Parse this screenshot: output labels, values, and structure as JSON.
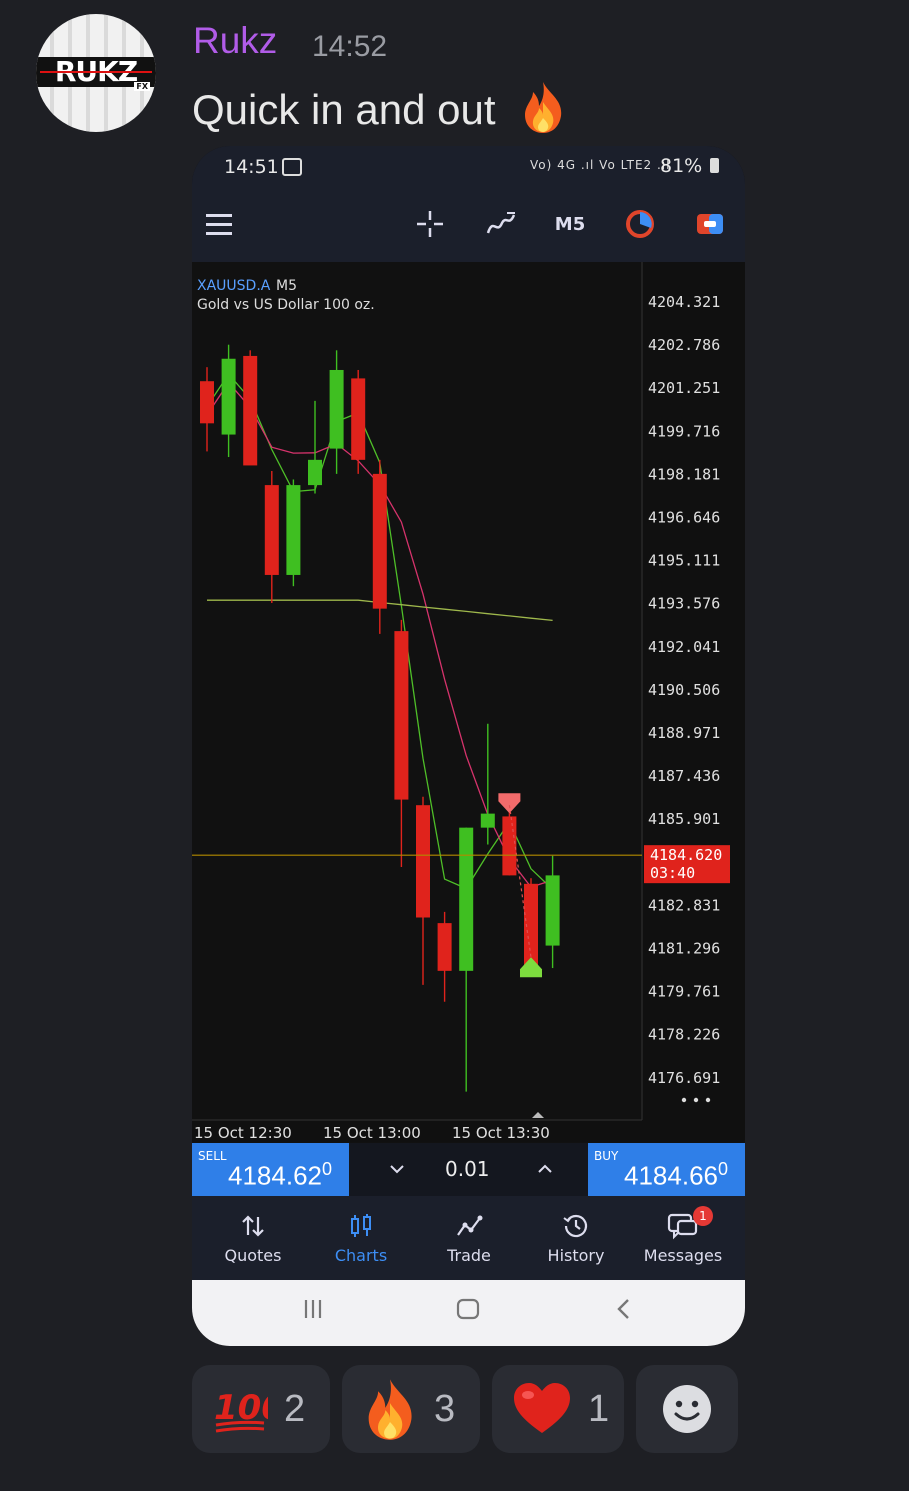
{
  "message": {
    "username": "Rukz",
    "timestamp": "14:52",
    "text": "Quick in and out",
    "text_emoji_icon": "fire-icon",
    "avatar_logo_text": "RUKZ",
    "avatar_logo_sub": "FX",
    "username_color": "#b15ce8"
  },
  "phone": {
    "status_bar": {
      "time": "14:51",
      "icons_text": "Vo) 4G .ıl Vo LTE2 .ıl",
      "battery": "81%"
    },
    "toolbar": {
      "timeframe": "M5",
      "icons": [
        "menu-icon",
        "crosshair-icon",
        "indicators-icon",
        "objects-icon",
        "trade-icon"
      ]
    },
    "chart": {
      "symbol": "XAUUSD.A",
      "symbol_timeframe": "M5",
      "description": "Gold vs US Dollar 100 oz.",
      "current_price": "4184.620",
      "countdown": "03:40",
      "more_icon": "more-dots-icon"
    },
    "order_bar": {
      "sell_label": "SELL",
      "sell_price_main": "4184.62",
      "sell_price_sup": "0",
      "volume": "0.01",
      "buy_label": "BUY",
      "buy_price_main": "4184.66",
      "buy_price_sup": "0",
      "accent": "#2f7fe8"
    },
    "bottom_nav": [
      {
        "label": "Quotes",
        "icon": "quotes-arrows-icon"
      },
      {
        "label": "Charts",
        "icon": "candles-icon"
      },
      {
        "label": "Trade",
        "icon": "trade-line-icon"
      },
      {
        "label": "History",
        "icon": "history-clock-icon"
      },
      {
        "label": "Messages",
        "icon": "messages-icon",
        "badge": "1"
      }
    ]
  },
  "chart_data": {
    "type": "candlestick",
    "price_axis_ticks": [
      "4204.321",
      "4202.786",
      "4201.251",
      "4199.716",
      "4198.181",
      "4196.646",
      "4195.111",
      "4193.576",
      "4192.041",
      "4190.506",
      "4188.971",
      "4187.436",
      "4185.901",
      "4182.831",
      "4181.296",
      "4179.761",
      "4178.226",
      "4176.691"
    ],
    "time_axis_ticks": [
      "15 Oct 12:30",
      "15 Oct 13:00",
      "15 Oct 13:30"
    ],
    "ylim": [
      4176.691,
      4204.321
    ],
    "bid_line": 4184.62,
    "candles": [
      {
        "o": 4201.5,
        "h": 4202.0,
        "l": 4199.0,
        "c": 4200.0
      },
      {
        "o": 4199.6,
        "h": 4202.8,
        "l": 4198.8,
        "c": 4202.3
      },
      {
        "o": 4202.4,
        "h": 4202.6,
        "l": 4199.2,
        "c": 4198.5
      },
      {
        "o": 4197.8,
        "h": 4198.3,
        "l": 4193.6,
        "c": 4194.6
      },
      {
        "o": 4194.6,
        "h": 4198.0,
        "l": 4194.2,
        "c": 4197.8
      },
      {
        "o": 4197.8,
        "h": 4200.8,
        "l": 4197.5,
        "c": 4198.7
      },
      {
        "o": 4199.1,
        "h": 4202.6,
        "l": 4198.2,
        "c": 4201.9
      },
      {
        "o": 4201.6,
        "h": 4201.9,
        "l": 4198.2,
        "c": 4198.7
      },
      {
        "o": 4198.2,
        "h": 4198.7,
        "l": 4192.5,
        "c": 4193.4
      },
      {
        "o": 4192.6,
        "h": 4193.0,
        "l": 4184.2,
        "c": 4186.6
      },
      {
        "o": 4186.4,
        "h": 4186.7,
        "l": 4180.0,
        "c": 4182.4
      },
      {
        "o": 4182.2,
        "h": 4182.6,
        "l": 4179.4,
        "c": 4180.5
      },
      {
        "o": 4180.5,
        "h": 4185.6,
        "l": 4176.2,
        "c": 4185.6
      },
      {
        "o": 4185.6,
        "h": 4189.3,
        "l": 4185.0,
        "c": 4186.1
      },
      {
        "o": 4186.0,
        "h": 4186.5,
        "l": 4183.9,
        "c": 4183.9
      },
      {
        "o": 4183.6,
        "h": 4183.8,
        "l": 4181.4,
        "c": 4180.6
      },
      {
        "o": 4181.4,
        "h": 4184.6,
        "l": 4180.6,
        "c": 4183.9
      }
    ],
    "markers": [
      {
        "type": "sell",
        "candle": 14,
        "price": 4186.4
      },
      {
        "type": "buy",
        "candle": 15,
        "price": 4180.7
      }
    ],
    "colors": {
      "bull": "#3fbf21",
      "bear": "#e0231c",
      "ma_fast": "#4fbf28",
      "ma_slow": "#d6336c",
      "ma_long": "#9fb84c",
      "bid": "#b38a00",
      "price_label_bg": "#e0231c"
    }
  },
  "reactions": [
    {
      "emoji": "hundred-points-icon",
      "count": "2"
    },
    {
      "emoji": "fire-icon",
      "count": "3"
    },
    {
      "emoji": "red-heart-icon",
      "count": "1"
    }
  ],
  "add_reaction_icon": "smiley-face-icon"
}
